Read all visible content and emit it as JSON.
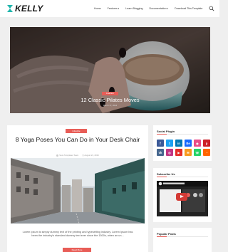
{
  "header": {
    "logo_text": "KELLY",
    "nav": [
      {
        "label": "Home",
        "has_caret": false
      },
      {
        "label": "Features",
        "has_caret": true
      },
      {
        "label": "Learn Blogging",
        "has_caret": false
      },
      {
        "label": "Documentation",
        "has_caret": true
      },
      {
        "label": "Download This Template",
        "has_caret": false
      }
    ]
  },
  "hero": {
    "category": "Fashion",
    "title": "12 Classic Pilates Moves",
    "date": "March 17, 2016"
  },
  "article": {
    "category": "Lifestyle",
    "title": "8 Yoga Poses You Can Do in Your Desk Chair",
    "author": "Sora Templates Team",
    "date": "August 21, 2016",
    "excerpt": "Lorem Ipsum is simply dummy text of the printing and typesetting industry. Lorem Ipsum has been the industry's standard dummy text ever since the 1500s, when an un...",
    "read_more": "Read More"
  },
  "sidebar": {
    "social": {
      "title": "Social Plugin",
      "icons": [
        {
          "name": "facebook-icon",
          "glyph": "f",
          "color": "#3b5998"
        },
        {
          "name": "twitter-icon",
          "glyph": "t",
          "color": "#1da1f2"
        },
        {
          "name": "linkedin-icon",
          "glyph": "in",
          "color": "#0077b5"
        },
        {
          "name": "behance-icon",
          "glyph": "Be",
          "color": "#1769ff"
        },
        {
          "name": "dribbble-icon",
          "glyph": "◉",
          "color": "#ea4c89"
        },
        {
          "name": "pinterest-icon",
          "glyph": "p",
          "color": "#cb2027"
        },
        {
          "name": "vk-icon",
          "glyph": "vk",
          "color": "#45668e"
        },
        {
          "name": "instagram-icon",
          "glyph": "◎",
          "color": "#c13584"
        },
        {
          "name": "youtube-icon",
          "glyph": "▶",
          "color": "#e52d27"
        },
        {
          "name": "email-icon",
          "glyph": "✉",
          "color": "#f89a1e"
        },
        {
          "name": "whatsapp-icon",
          "glyph": "☏",
          "color": "#25d366"
        },
        {
          "name": "rss-icon",
          "glyph": "◔",
          "color": "#ff6600"
        }
      ]
    },
    "subscribe": {
      "title": "Subscribe Us"
    },
    "popular": {
      "title": "Popular Posts"
    }
  },
  "colors": {
    "accent": "#e85d57",
    "background": "#efefef",
    "text": "#1c1c1c"
  }
}
